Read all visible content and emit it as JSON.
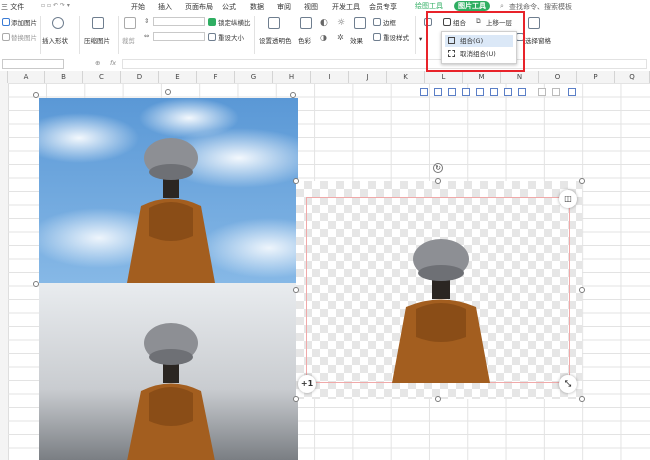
{
  "menubar": {
    "file": "三 文件",
    "tabs": [
      "开始",
      "插入",
      "页面布局",
      "公式",
      "数据",
      "审阅",
      "视图",
      "开发工具",
      "会员专享"
    ],
    "context_draw": "绘图工具",
    "context_picture": "图片工具",
    "search": "查找命令、搜索模板"
  },
  "ribbon": {
    "add_picture": "添加图片",
    "replace_picture": "替换图片",
    "insert_shape": "插入形状",
    "compress_picture": "压缩图片",
    "crop": "裁剪",
    "lock_ratio": "锁定纵横比",
    "reset_size": "重设大小",
    "set_transparent": "设置透明色",
    "color": "色彩",
    "effects": "效果",
    "border": "边框",
    "reset_style": "重设样式",
    "combine": "组合",
    "bring_forward": "上移一层",
    "rotate": "旋转",
    "selection_pane": "选择窗格"
  },
  "dropdown": {
    "items": [
      {
        "label": "组合(G)"
      },
      {
        "label": "取消组合(U)"
      }
    ]
  },
  "formulabar": {
    "fx": "fx"
  },
  "columns": [
    "A",
    "B",
    "C",
    "D",
    "E",
    "F",
    "G",
    "H",
    "I",
    "J",
    "K",
    "L",
    "M",
    "N",
    "O",
    "P",
    "Q"
  ],
  "picture_badge": "+1",
  "colors": {
    "picture_tab_bg": "#2fae62",
    "draw_tab_text": "#2fae62",
    "highlight_red": "#e8232a",
    "selection_border": "#f0a9a9"
  }
}
